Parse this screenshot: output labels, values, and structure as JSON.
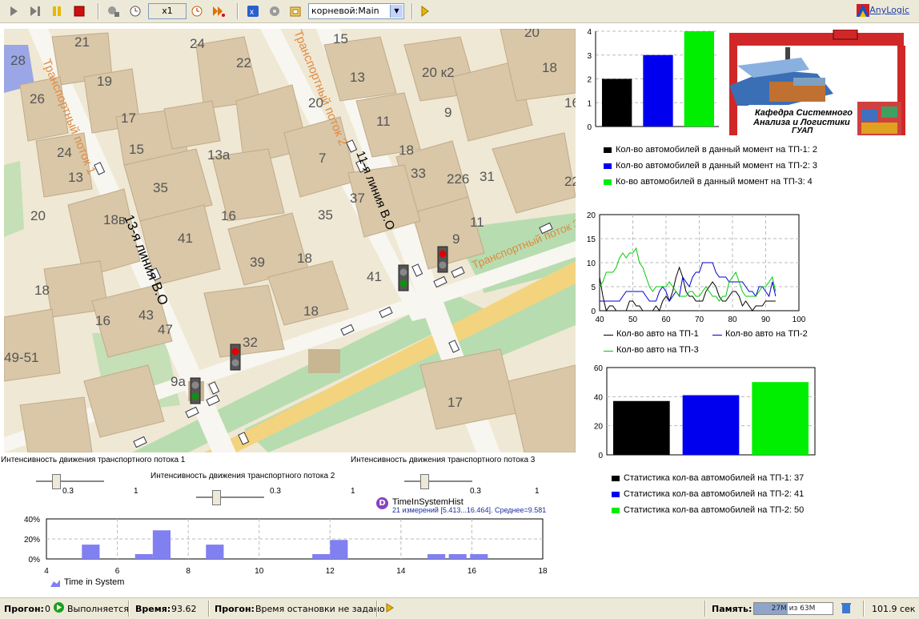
{
  "toolbar": {
    "speed": "x1",
    "root_combo": "корневой:Main",
    "brand": "AnyLogic",
    "icons": [
      "run-icon",
      "step-icon",
      "pause-icon",
      "stop-icon",
      "slower-icon",
      "clock-icon",
      "faster-icon",
      "run-until-icon",
      "experiment-icon",
      "settings-icon",
      "view-icon",
      "export-icon"
    ]
  },
  "map": {
    "streets": [
      "Транспортный поток 1",
      "Транспортный поток 2",
      "Транспортный поток 3",
      "13-я линия В.О",
      "11-я линия В.О"
    ],
    "buildings": [
      "28",
      "21",
      "24",
      "22",
      "15",
      "20",
      "13",
      "20 к2",
      "18",
      "19",
      "26",
      "17",
      "16",
      "13а",
      "20",
      "11",
      "9",
      "24",
      "15",
      "18",
      "7",
      "33",
      "31",
      "22",
      "13",
      "35",
      "226",
      "20",
      "18в",
      "16",
      "37",
      "35",
      "11",
      "9",
      "41",
      "39",
      "18",
      "41",
      "18",
      "18",
      "16",
      "43",
      "47",
      "32",
      "9а",
      "17",
      "49-51"
    ]
  },
  "bar_top": {
    "legend": [
      {
        "label": "Кол-во автомобилей в данный момент на ТП-1: 2",
        "color": "#000000"
      },
      {
        "label": "Кол-во автомобилей в данный момент на ТП-2: 3",
        "color": "#0000ee"
      },
      {
        "label": "Ко-во автомобилей в данный момент на ТП-3: 4",
        "color": "#00ee00"
      }
    ]
  },
  "logo": {
    "title1": "Кафедра Системного",
    "title2": "Анализа и Логистики",
    "title3": "ГУАП"
  },
  "line_chart_legend": [
    {
      "label": "Кол-во авто на ТП-1",
      "color": "#000000"
    },
    {
      "label": "Кол-во авто на ТП-2",
      "color": "#0000cc"
    },
    {
      "label": "Кол-во авто на ТП-3",
      "color": "#00cc00"
    }
  ],
  "bar_bottom_legend": [
    {
      "label": "Статистика кол-ва автомобилей на ТП-1: 37",
      "color": "#000000"
    },
    {
      "label": "Статистика кол-ва автомобилей на ТП-2: 41",
      "color": "#0000ee"
    },
    {
      "label": "Статистика кол-ва автомобилей на ТП-2: 50",
      "color": "#00ee00"
    }
  ],
  "sliders": [
    {
      "title": "Интенсивность движения транспортного потока 1",
      "value": "0.3",
      "max": "1",
      "fraction": 0.3
    },
    {
      "title": "Интенсивность движения транспортного потока 2",
      "value": "0.3",
      "max": "1",
      "fraction": 0.3
    },
    {
      "title": "Интенсивность движения транспортного потока 3",
      "value": "0.3",
      "max": "1",
      "fraction": 0.3
    }
  ],
  "dataset": {
    "badge": "D",
    "name": "TimeInSystemHist",
    "summary": "21 измерений [5.413...16.464]. Среднее=9.581"
  },
  "histogram_legend": "Time in System",
  "status": {
    "run_label": "Прогон:",
    "run_value": "0",
    "state": "Выполняется",
    "time_label": "Время:",
    "time_value": "93.62",
    "stop_label": "Прогон:",
    "stop_value": "Время остановки не задано",
    "memory_label": "Память:",
    "memory_value": "27M из 63M",
    "memory_fraction": 0.43,
    "elapsed": "101.9 сек"
  },
  "chart_data": [
    {
      "type": "bar",
      "categories": [
        "ТП-1",
        "ТП-2",
        "ТП-3"
      ],
      "values": [
        2,
        3,
        4
      ],
      "colors": [
        "#000000",
        "#0000ee",
        "#00ee00"
      ],
      "ylim": [
        0,
        4
      ],
      "yticks": [
        "0",
        "1",
        "2",
        "3",
        "4"
      ]
    },
    {
      "type": "line",
      "xlim": [
        40,
        100
      ],
      "ylim": [
        0,
        20
      ],
      "xticks": [
        "40",
        "50",
        "60",
        "70",
        "80",
        "90",
        "100"
      ],
      "yticks": [
        "0",
        "5",
        "10",
        "15",
        "20"
      ],
      "series": [
        {
          "name": "Кол-во авто на ТП-1",
          "color": "#000000",
          "points": [
            [
              40,
              7
            ],
            [
              41,
              3
            ],
            [
              42,
              0
            ],
            [
              43,
              1
            ],
            [
              44,
              1
            ],
            [
              45,
              0
            ],
            [
              46,
              0
            ],
            [
              47,
              0
            ],
            [
              48,
              0
            ],
            [
              49,
              2
            ],
            [
              50,
              2
            ],
            [
              51,
              1
            ],
            [
              52,
              1
            ],
            [
              53,
              0
            ],
            [
              54,
              0
            ],
            [
              55,
              0
            ],
            [
              56,
              0
            ],
            [
              57,
              1
            ],
            [
              58,
              0
            ],
            [
              59,
              2
            ],
            [
              60,
              3
            ],
            [
              61,
              2
            ],
            [
              62,
              4
            ],
            [
              63,
              7
            ],
            [
              64,
              9
            ],
            [
              65,
              7
            ],
            [
              66,
              4
            ],
            [
              67,
              3
            ],
            [
              68,
              3
            ],
            [
              69,
              2
            ],
            [
              70,
              2
            ],
            [
              71,
              2
            ],
            [
              72,
              4
            ],
            [
              73,
              5
            ],
            [
              74,
              6
            ],
            [
              75,
              5
            ],
            [
              76,
              3
            ],
            [
              77,
              2
            ],
            [
              78,
              2
            ],
            [
              79,
              3
            ],
            [
              80,
              4
            ],
            [
              81,
              4
            ],
            [
              82,
              3
            ],
            [
              83,
              1
            ],
            [
              84,
              2
            ],
            [
              85,
              1
            ],
            [
              86,
              0
            ],
            [
              87,
              1
            ],
            [
              88,
              1
            ],
            [
              89,
              1
            ],
            [
              90,
              2
            ],
            [
              91,
              2
            ],
            [
              92,
              2
            ],
            [
              93,
              2
            ]
          ]
        },
        {
          "name": "Кол-во авто на ТП-2",
          "color": "#0000cc",
          "points": [
            [
              40,
              2
            ],
            [
              41,
              2
            ],
            [
              42,
              2
            ],
            [
              43,
              2
            ],
            [
              44,
              2
            ],
            [
              45,
              2
            ],
            [
              46,
              2
            ],
            [
              47,
              3
            ],
            [
              48,
              4
            ],
            [
              49,
              4
            ],
            [
              50,
              4
            ],
            [
              51,
              4
            ],
            [
              52,
              4
            ],
            [
              53,
              4
            ],
            [
              54,
              3
            ],
            [
              55,
              2
            ],
            [
              56,
              2
            ],
            [
              57,
              2
            ],
            [
              58,
              4
            ],
            [
              59,
              5
            ],
            [
              60,
              4
            ],
            [
              61,
              2
            ],
            [
              62,
              3
            ],
            [
              63,
              4
            ],
            [
              64,
              3
            ],
            [
              65,
              7
            ],
            [
              66,
              6
            ],
            [
              67,
              5
            ],
            [
              68,
              7
            ],
            [
              69,
              8
            ],
            [
              70,
              8
            ],
            [
              71,
              10
            ],
            [
              72,
              10
            ],
            [
              73,
              10
            ],
            [
              74,
              10
            ],
            [
              75,
              8
            ],
            [
              76,
              7
            ],
            [
              77,
              7
            ],
            [
              78,
              7
            ],
            [
              79,
              6
            ],
            [
              80,
              6
            ],
            [
              81,
              6
            ],
            [
              82,
              6
            ],
            [
              83,
              6
            ],
            [
              84,
              5
            ],
            [
              85,
              4
            ],
            [
              86,
              4
            ],
            [
              87,
              3
            ],
            [
              88,
              5
            ],
            [
              89,
              5
            ],
            [
              90,
              4
            ],
            [
              91,
              3
            ],
            [
              92,
              6
            ],
            [
              93,
              3
            ]
          ]
        },
        {
          "name": "Кол-во авто на ТП-3",
          "color": "#00cc00",
          "points": [
            [
              40,
              5
            ],
            [
              41,
              6
            ],
            [
              42,
              8
            ],
            [
              43,
              8
            ],
            [
              44,
              8
            ],
            [
              45,
              9
            ],
            [
              46,
              11
            ],
            [
              47,
              12
            ],
            [
              48,
              11
            ],
            [
              49,
              12
            ],
            [
              50,
              12
            ],
            [
              51,
              13
            ],
            [
              52,
              10
            ],
            [
              53,
              9
            ],
            [
              54,
              7
            ],
            [
              55,
              5
            ],
            [
              56,
              4
            ],
            [
              57,
              5
            ],
            [
              58,
              5
            ],
            [
              59,
              5
            ],
            [
              60,
              5
            ],
            [
              61,
              6
            ],
            [
              62,
              5
            ],
            [
              63,
              4
            ],
            [
              64,
              3
            ],
            [
              65,
              3
            ],
            [
              66,
              3
            ],
            [
              67,
              4
            ],
            [
              68,
              4
            ],
            [
              69,
              3
            ],
            [
              70,
              3
            ],
            [
              71,
              4
            ],
            [
              72,
              5
            ],
            [
              73,
              4
            ],
            [
              74,
              3
            ],
            [
              75,
              3
            ],
            [
              76,
              2
            ],
            [
              77,
              3
            ],
            [
              78,
              3
            ],
            [
              79,
              6
            ],
            [
              80,
              7
            ],
            [
              81,
              8
            ],
            [
              82,
              6
            ],
            [
              83,
              4
            ],
            [
              84,
              3
            ],
            [
              85,
              3
            ],
            [
              86,
              3
            ],
            [
              87,
              3
            ],
            [
              88,
              4
            ],
            [
              89,
              5
            ],
            [
              90,
              5
            ],
            [
              91,
              6
            ],
            [
              92,
              7
            ],
            [
              93,
              4
            ]
          ]
        }
      ]
    },
    {
      "type": "bar",
      "categories": [
        "ТП-1",
        "ТП-2",
        "ТП-3"
      ],
      "values": [
        37,
        41,
        50
      ],
      "colors": [
        "#000000",
        "#0000ee",
        "#00ee00"
      ],
      "ylim": [
        0,
        60
      ],
      "yticks": [
        "0",
        "20",
        "40",
        "60"
      ]
    },
    {
      "type": "bar",
      "title": "TimeInSystemHist",
      "xlim": [
        4,
        18
      ],
      "ylim": [
        0,
        0.4
      ],
      "xticks": [
        "4",
        "6",
        "8",
        "10",
        "12",
        "14",
        "16",
        "18"
      ],
      "yticks": [
        "40%",
        "20%",
        "0%"
      ],
      "bin_width": 0.5,
      "bars": [
        [
          5,
          0.143
        ],
        [
          6.5,
          0.048
        ],
        [
          7,
          0.286
        ],
        [
          8.5,
          0.143
        ],
        [
          11.5,
          0.048
        ],
        [
          12,
          0.19
        ],
        [
          14.75,
          0.048
        ],
        [
          15.35,
          0.048
        ],
        [
          15.95,
          0.048
        ]
      ],
      "color": "#8080f0"
    }
  ]
}
